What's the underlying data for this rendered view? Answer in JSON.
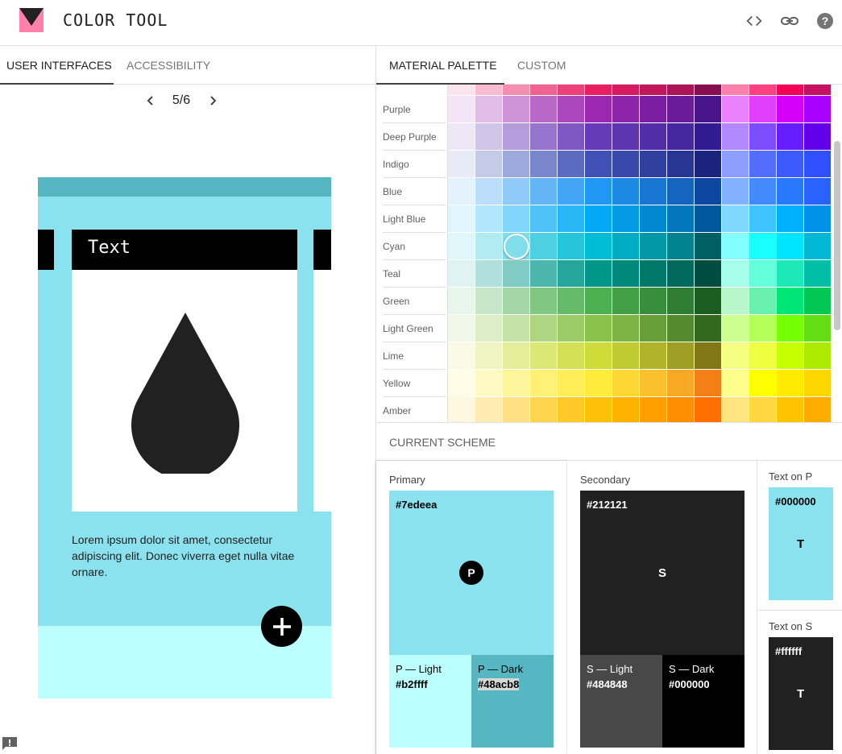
{
  "header": {
    "title": "COLOR TOOL",
    "icons": [
      "code-icon",
      "link-icon",
      "help-icon"
    ]
  },
  "left_tabs": [
    {
      "label": "USER INTERFACES",
      "active": true
    },
    {
      "label": "ACCESSIBILITY",
      "active": false
    }
  ],
  "pager": {
    "text": "5/6"
  },
  "preview": {
    "card_text": "Text",
    "body_text": "Lorem ipsum dolor sit amet, consectetur adipiscing elit. Donec viverra eget nulla vitae ornare.",
    "colors": {
      "primary": "#8ae2ee",
      "primary_dark": "#56b6c2",
      "primary_light": "#bbffff",
      "black": "#000000",
      "drop": "#212121"
    }
  },
  "right_tabs": [
    {
      "label": "MATERIAL PALETTE",
      "active": true
    },
    {
      "label": "CUSTOM",
      "active": false
    }
  ],
  "palette": {
    "rows": [
      {
        "name": "",
        "colors": [
          "#fce4ec",
          "#f8bbd0",
          "#f48fb1",
          "#f06292",
          "#ec407a",
          "#e91e63",
          "#d81b60",
          "#c2185b",
          "#ad1457",
          "#880e4f",
          "#ff80ab",
          "#ff4081",
          "#f50057",
          "#c51162"
        ]
      },
      {
        "name": "Purple",
        "colors": [
          "#f3e5f5",
          "#e1bee7",
          "#ce93d8",
          "#ba68c8",
          "#ab47bc",
          "#9c27b0",
          "#8e24aa",
          "#7b1fa2",
          "#6a1b9a",
          "#4a148c",
          "#ea80fc",
          "#e040fb",
          "#d500f9",
          "#aa00ff"
        ]
      },
      {
        "name": "Deep Purple",
        "colors": [
          "#ede7f6",
          "#d1c4e9",
          "#b39ddb",
          "#9575cd",
          "#7e57c2",
          "#673ab7",
          "#5e35b1",
          "#512da8",
          "#4527a0",
          "#311b92",
          "#b388ff",
          "#7c4dff",
          "#651fff",
          "#6200ea"
        ]
      },
      {
        "name": "Indigo",
        "colors": [
          "#e8eaf6",
          "#c5cae9",
          "#9fa8da",
          "#7986cb",
          "#5c6bc0",
          "#3f51b5",
          "#3949ab",
          "#303f9f",
          "#283593",
          "#1a237e",
          "#8c9eff",
          "#536dfe",
          "#3d5afe",
          "#304ffe"
        ]
      },
      {
        "name": "Blue",
        "colors": [
          "#e3f2fd",
          "#bbdefb",
          "#90caf9",
          "#64b5f6",
          "#42a5f5",
          "#2196f3",
          "#1e88e5",
          "#1976d2",
          "#1565c0",
          "#0d47a1",
          "#82b1ff",
          "#448aff",
          "#2979ff",
          "#2962ff"
        ]
      },
      {
        "name": "Light Blue",
        "colors": [
          "#e1f5fe",
          "#b3e5fc",
          "#81d4fa",
          "#4fc3f7",
          "#29b6f6",
          "#03a9f4",
          "#039be5",
          "#0288d1",
          "#0277bd",
          "#01579b",
          "#80d8ff",
          "#40c4ff",
          "#00b0ff",
          "#0091ea"
        ]
      },
      {
        "name": "Cyan",
        "colors": [
          "#e0f7fa",
          "#b2ebf2",
          "#80deea",
          "#4dd0e1",
          "#26c6da",
          "#00bcd4",
          "#00acc1",
          "#0097a7",
          "#00838f",
          "#006064",
          "#84ffff",
          "#18ffff",
          "#00e5ff",
          "#00b8d4"
        ]
      },
      {
        "name": "Teal",
        "colors": [
          "#e0f2f1",
          "#b2dfdb",
          "#80cbc4",
          "#4db6ac",
          "#26a69a",
          "#009688",
          "#00897b",
          "#00796b",
          "#00695c",
          "#004d40",
          "#a7ffeb",
          "#64ffda",
          "#1de9b6",
          "#00bfa5"
        ]
      },
      {
        "name": "Green",
        "colors": [
          "#e8f5e9",
          "#c8e6c9",
          "#a5d6a7",
          "#81c784",
          "#66bb6a",
          "#4caf50",
          "#43a047",
          "#388e3c",
          "#2e7d32",
          "#1b5e20",
          "#b9f6ca",
          "#69f0ae",
          "#00e676",
          "#00c853"
        ]
      },
      {
        "name": "Light Green",
        "colors": [
          "#f1f8e9",
          "#dcedc8",
          "#c5e1a5",
          "#aed581",
          "#9ccc65",
          "#8bc34a",
          "#7cb342",
          "#689f38",
          "#558b2f",
          "#33691e",
          "#ccff90",
          "#b2ff59",
          "#76ff03",
          "#64dd17"
        ]
      },
      {
        "name": "Lime",
        "colors": [
          "#f9fbe7",
          "#f0f4c3",
          "#e6ee9c",
          "#dce775",
          "#d4e157",
          "#cddc39",
          "#c0ca33",
          "#afb42b",
          "#9e9d24",
          "#827717",
          "#f4ff81",
          "#eeff41",
          "#c6ff00",
          "#aeea00"
        ]
      },
      {
        "name": "Yellow",
        "colors": [
          "#fffde7",
          "#fff9c4",
          "#fff59d",
          "#fff176",
          "#ffee58",
          "#ffeb3b",
          "#fdd835",
          "#fbc02d",
          "#f9a825",
          "#f57f17",
          "#ffff8d",
          "#ffff00",
          "#ffea00",
          "#ffd600"
        ]
      },
      {
        "name": "Amber",
        "colors": [
          "#fff8e1",
          "#ffecb3",
          "#ffe082",
          "#ffd54f",
          "#ffca28",
          "#ffc107",
          "#ffb300",
          "#ffa000",
          "#ff8f00",
          "#ff6f00",
          "#ffe57f",
          "#ffd740",
          "#ffc400",
          "#ffab00"
        ]
      }
    ],
    "selected": {
      "row": 6,
      "col": 2
    }
  },
  "scheme": {
    "title": "CURRENT SCHEME",
    "primary": {
      "label": "Primary",
      "hex": "#7edeea",
      "letter": "P",
      "light_label": "P — Light",
      "light_hex": "#b2ffff",
      "dark_label": "P — Dark",
      "dark_hex": "#48acb8",
      "colors": {
        "main": "#8ae2ee",
        "light": "#bbffff",
        "dark": "#56b6c2"
      }
    },
    "secondary": {
      "label": "Secondary",
      "hex": "#212121",
      "letter": "S",
      "light_label": "S — Light",
      "light_hex": "#484848",
      "dark_label": "S — Dark",
      "dark_hex": "#000000",
      "colors": {
        "main": "#212121",
        "light": "#484848",
        "dark": "#000000"
      }
    },
    "text_on_primary": {
      "label": "Text on P",
      "hex": "#000000",
      "letter": "T",
      "bg": "#8ae2ee"
    },
    "text_on_secondary": {
      "label": "Text on S",
      "hex": "#ffffff",
      "letter": "T",
      "bg": "#212121"
    }
  }
}
